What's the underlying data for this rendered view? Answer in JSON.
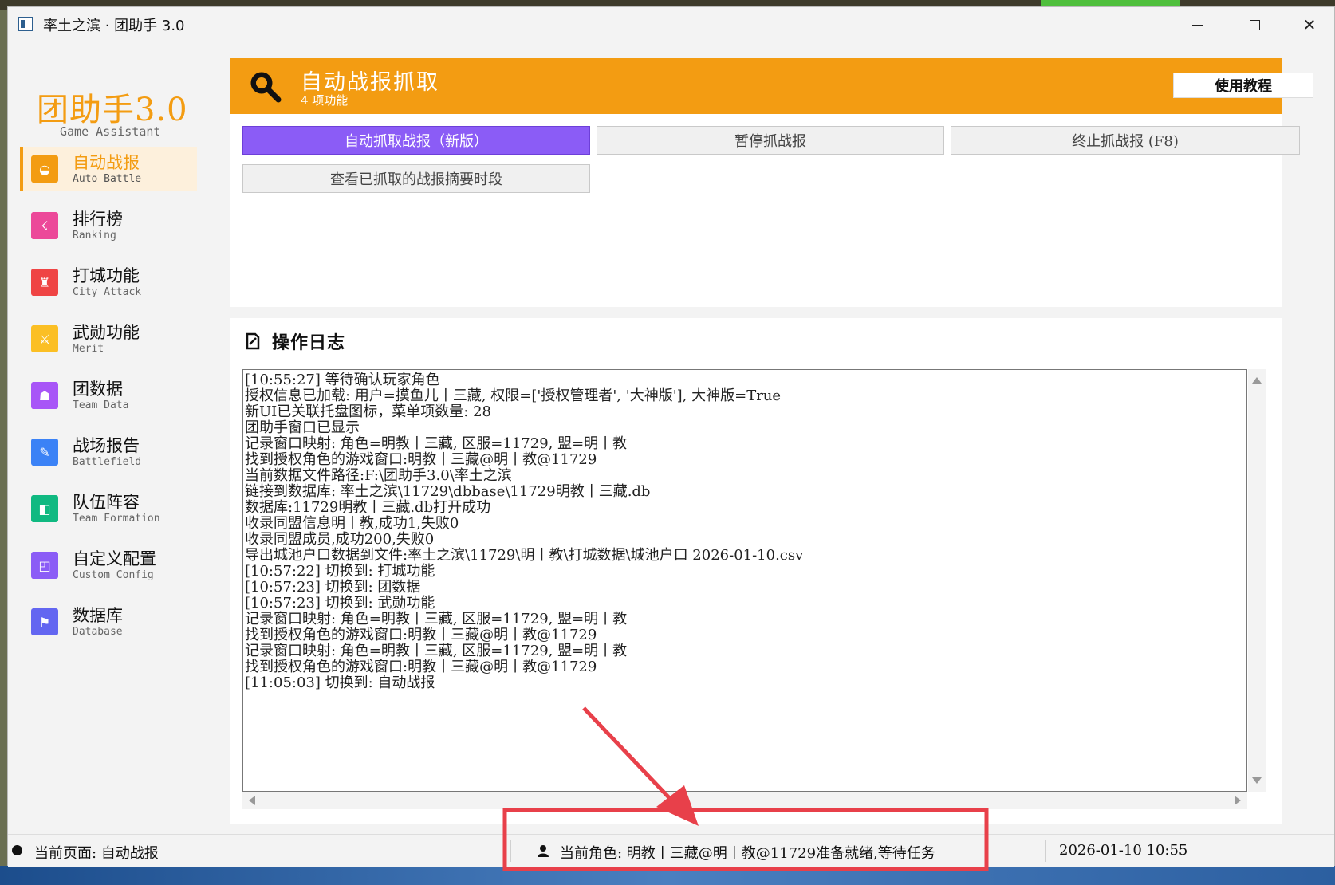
{
  "window": {
    "title": "率土之滨 · 团助手 3.0",
    "minimize_glyph": "—",
    "close_glyph": "✕"
  },
  "sidebar": {
    "brand_title": "团助手3.0",
    "brand_subtitle": "Game Assistant",
    "items": [
      {
        "label": "自动战报",
        "sub": "Auto Battle",
        "color": "#f39c12",
        "icon": "camera-icon",
        "glyph": "◒",
        "active": true
      },
      {
        "label": "排行榜",
        "sub": "Ranking",
        "color": "#ec4899",
        "icon": "ranking-icon",
        "glyph": "☇",
        "active": false
      },
      {
        "label": "打城功能",
        "sub": "City Attack",
        "color": "#ef4444",
        "icon": "city-icon",
        "glyph": "♜",
        "active": false
      },
      {
        "label": "武勋功能",
        "sub": "Merit",
        "color": "#fbbf24",
        "icon": "swords-icon",
        "glyph": "⚔",
        "active": false
      },
      {
        "label": "团数据",
        "sub": "Team Data",
        "color": "#a855f7",
        "icon": "team-icon",
        "glyph": "☗",
        "active": false
      },
      {
        "label": "战场报告",
        "sub": "Battlefield",
        "color": "#3b82f6",
        "icon": "pen-icon",
        "glyph": "✎",
        "active": false
      },
      {
        "label": "队伍阵容",
        "sub": "Team Formation",
        "color": "#10b981",
        "icon": "formation-icon",
        "glyph": "◧",
        "active": false
      },
      {
        "label": "自定义配置",
        "sub": "Custom Config",
        "color": "#8b5cf6",
        "icon": "config-icon",
        "glyph": "◰",
        "active": false
      },
      {
        "label": "数据库",
        "sub": "Database",
        "color": "#6366f1",
        "icon": "database-icon",
        "glyph": "⚑",
        "active": false
      }
    ]
  },
  "banner": {
    "title": "自动战报抓取",
    "subtitle": "4 项功能",
    "tutorial_button": "使用教程",
    "color": "#f39c12",
    "icon": "search-icon"
  },
  "actions": {
    "auto_capture": "自动抓取战报（新版）",
    "pause_capture": "暂停抓战报",
    "stop_capture": "终止抓战报 (F8)",
    "view_summary": "查看已抓取的战报摘要时段",
    "primary_color": "#8b5cf6"
  },
  "log": {
    "title": "操作日志",
    "icon": "edit-icon",
    "lines": [
      "[10:55:27] 等待确认玩家角色",
      "授权信息已加载: 用户=摸鱼儿丨三藏, 权限=['授权管理者', '大神版'], 大神版=True",
      "新UI已关联托盘图标，菜单项数量: 28",
      "团助手窗口已显示",
      "记录窗口映射: 角色=明教丨三藏, 区服=11729, 盟=明丨教",
      "找到授权角色的游戏窗口:明教丨三藏@明丨教@11729",
      "当前数据文件路径:F:\\团助手3.0\\率土之滨",
      "链接到数据库: 率土之滨\\11729\\dbbase\\11729明教丨三藏.db",
      "数据库:11729明教丨三藏.db打开成功",
      "收录同盟信息明丨教,成功1,失败0",
      "收录同盟成员,成功200,失败0",
      "导出城池户口数据到文件:率土之滨\\11729\\明丨教\\打城数据\\城池户口 2026-01-10.csv",
      "[10:57:22] 切换到: 打城功能",
      "[10:57:23] 切换到: 团数据",
      "[10:57:23] 切换到: 武勋功能",
      "记录窗口映射: 角色=明教丨三藏, 区服=11729, 盟=明丨教",
      "找到授权角色的游戏窗口:明教丨三藏@明丨教@11729",
      "记录窗口映射: 角色=明教丨三藏, 区服=11729, 盟=明丨教",
      "找到授权角色的游戏窗口:明教丨三藏@明丨教@11729",
      "[11:05:03] 切换到: 自动战报"
    ]
  },
  "status": {
    "current_page": "当前页面: 自动战报",
    "current_role": "当前角色: 明教丨三藏@明丨教@11729准备就绪,等待任务",
    "datetime": "2026-01-10 10:55"
  },
  "annotation": {
    "color": "#e8404a"
  }
}
